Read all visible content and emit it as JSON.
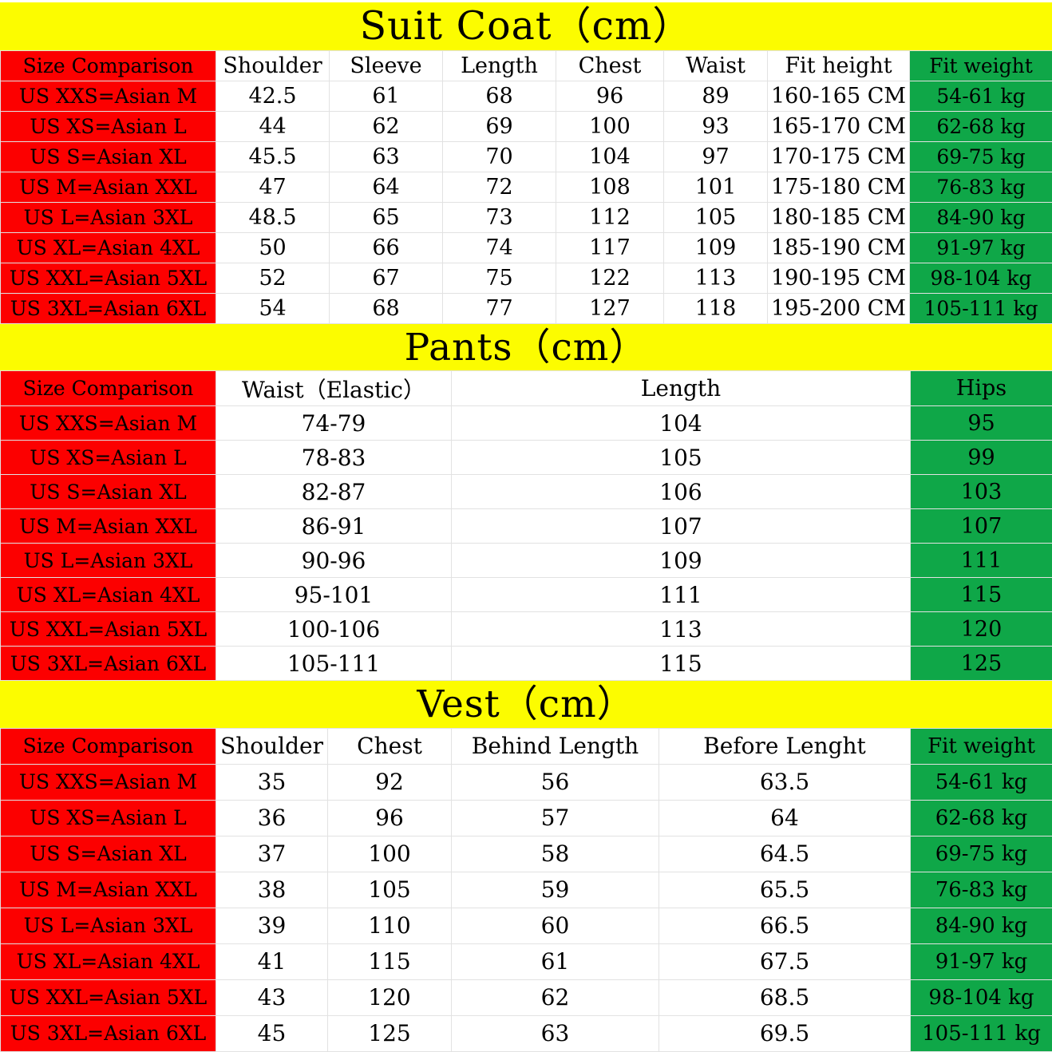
{
  "colors": {
    "banner_yellow": "#FCFC00",
    "size_red": "#FC0000",
    "weight_green": "#0FA748",
    "cell_background": "#FFFFFF",
    "text": "#000000",
    "grid_line": "#E2E2E2"
  },
  "sections": [
    {
      "id": "suit-coat",
      "title": "Suit Coat（cm）",
      "columns": [
        "Size Comparison",
        "Shoulder",
        "Sleeve",
        "Length",
        "Chest",
        "Waist",
        "Fit height",
        "Fit weight"
      ],
      "rows": [
        [
          "US XXS=Asian M",
          "42.5",
          "61",
          "68",
          "96",
          "89",
          "160-165 CM",
          "54-61 kg"
        ],
        [
          "US XS=Asian L",
          "44",
          "62",
          "69",
          "100",
          "93",
          "165-170 CM",
          "62-68 kg"
        ],
        [
          "US S=Asian XL",
          "45.5",
          "63",
          "70",
          "104",
          "97",
          "170-175 CM",
          "69-75 kg"
        ],
        [
          "US M=Asian XXL",
          "47",
          "64",
          "72",
          "108",
          "101",
          "175-180 CM",
          "76-83 kg"
        ],
        [
          "US L=Asian 3XL",
          "48.5",
          "65",
          "73",
          "112",
          "105",
          "180-185 CM",
          "84-90 kg"
        ],
        [
          "US XL=Asian 4XL",
          "50",
          "66",
          "74",
          "117",
          "109",
          "185-190 CM",
          "91-97 kg"
        ],
        [
          "US XXL=Asian 5XL",
          "52",
          "67",
          "75",
          "122",
          "113",
          "190-195 CM",
          "98-104 kg"
        ],
        [
          "US 3XL=Asian 6XL",
          "54",
          "68",
          "77",
          "127",
          "118",
          "195-200 CM",
          "105-111 kg"
        ]
      ]
    },
    {
      "id": "pants",
      "title": "Pants（cm）",
      "columns": [
        "Size Comparison",
        "Waist（Elastic）",
        "Length",
        "Hips"
      ],
      "rows": [
        [
          "US XXS=Asian M",
          "74-79",
          "104",
          "95"
        ],
        [
          "US XS=Asian L",
          "78-83",
          "105",
          "99"
        ],
        [
          "US S=Asian XL",
          "82-87",
          "106",
          "103"
        ],
        [
          "US M=Asian XXL",
          "86-91",
          "107",
          "107"
        ],
        [
          "US L=Asian 3XL",
          "90-96",
          "109",
          "111"
        ],
        [
          "US XL=Asian 4XL",
          "95-101",
          "111",
          "115"
        ],
        [
          "US XXL=Asian 5XL",
          "100-106",
          "113",
          "120"
        ],
        [
          "US 3XL=Asian 6XL",
          "105-111",
          "115",
          "125"
        ]
      ]
    },
    {
      "id": "vest",
      "title": "Vest（cm）",
      "columns": [
        "Size Comparison",
        "Shoulder",
        "Chest",
        "Behind Length",
        "Before Lenght",
        "Fit weight"
      ],
      "rows": [
        [
          "US XXS=Asian M",
          "35",
          "92",
          "56",
          "63.5",
          "54-61 kg"
        ],
        [
          "US XS=Asian L",
          "36",
          "96",
          "57",
          "64",
          "62-68 kg"
        ],
        [
          "US S=Asian XL",
          "37",
          "100",
          "58",
          "64.5",
          "69-75 kg"
        ],
        [
          "US M=Asian XXL",
          "38",
          "105",
          "59",
          "65.5",
          "76-83 kg"
        ],
        [
          "US L=Asian 3XL",
          "39",
          "110",
          "60",
          "66.5",
          "84-90 kg"
        ],
        [
          "US XL=Asian 4XL",
          "41",
          "115",
          "61",
          "67.5",
          "91-97 kg"
        ],
        [
          "US XXL=Asian 5XL",
          "43",
          "120",
          "62",
          "68.5",
          "98-104 kg"
        ],
        [
          "US 3XL=Asian 6XL",
          "45",
          "125",
          "63",
          "69.5",
          "105-111 kg"
        ]
      ]
    }
  ]
}
